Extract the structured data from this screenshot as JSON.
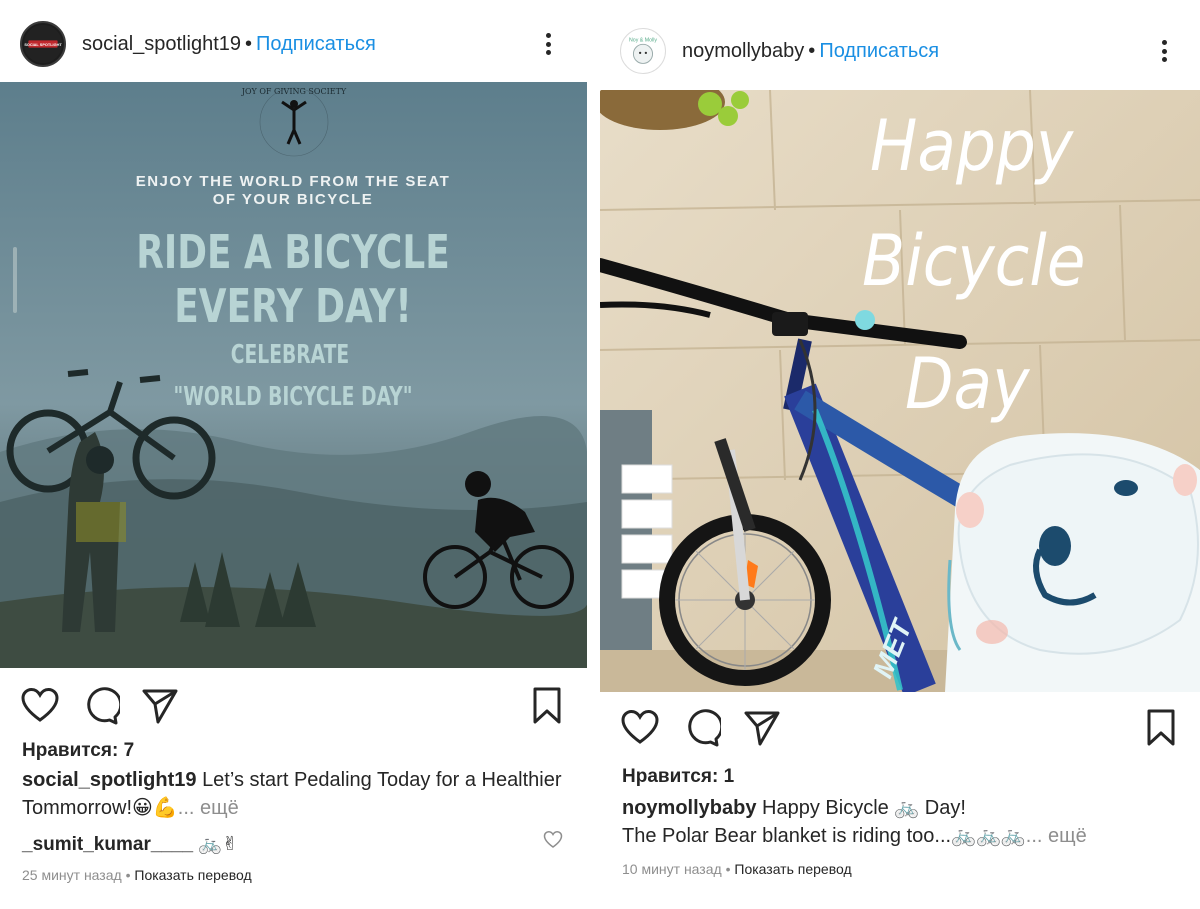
{
  "posts": [
    {
      "username": "social_spotlight19",
      "dot": "•",
      "subscribe": "Подписаться",
      "avatar_text": "SOCIAL SPOTLIGHT",
      "image": {
        "logo_text": "JOY OF GIVING SOCIETY",
        "tagline_line1": "ENJOY THE WORLD FROM THE SEAT",
        "tagline_line2": "OF YOUR BICYCLE",
        "headline_line1": "RIDE A BICYCLE",
        "headline_line2": "EVERY DAY!",
        "sub_line1": "CELEBRATE",
        "sub_line2": "\"WORLD BICYCLE DAY\""
      },
      "likes": "Нравится: 7",
      "caption_user": "social_spotlight19",
      "caption_line1": "Let’s start Pedaling Today for a Healthier",
      "caption_line2": "Tommorrow!😀💪",
      "caption_more": "... ещё",
      "comment_user": "_sumit_kumar____",
      "comment_text": "🚲✌",
      "time": "25 минут назад",
      "sep": "•",
      "translate": "Показать перевод"
    },
    {
      "username": "noymollybaby",
      "dot": "•",
      "subscribe": "Подписаться",
      "avatar_text": "Noy & Molly",
      "image": {
        "word1": "Happy",
        "word2": "Bicycle",
        "word3": "Day",
        "frame_text": "MET"
      },
      "likes": "Нравится: 1",
      "caption_user": "noymollybaby",
      "caption_line1": "Happy Bicycle 🚲 Day!",
      "caption_line2": "The Polar Bear blanket is riding too...🚲🚲🚲",
      "caption_more": "... ещё",
      "time": "10 минут назад",
      "sep": "•",
      "translate": "Показать перевод"
    }
  ],
  "colors": {
    "link_blue": "#1a8fe3",
    "text": "#262626",
    "muted": "#8e8e8e"
  },
  "icons": [
    "heart-icon",
    "comment-icon",
    "share-icon",
    "bookmark-icon",
    "more-icon"
  ]
}
